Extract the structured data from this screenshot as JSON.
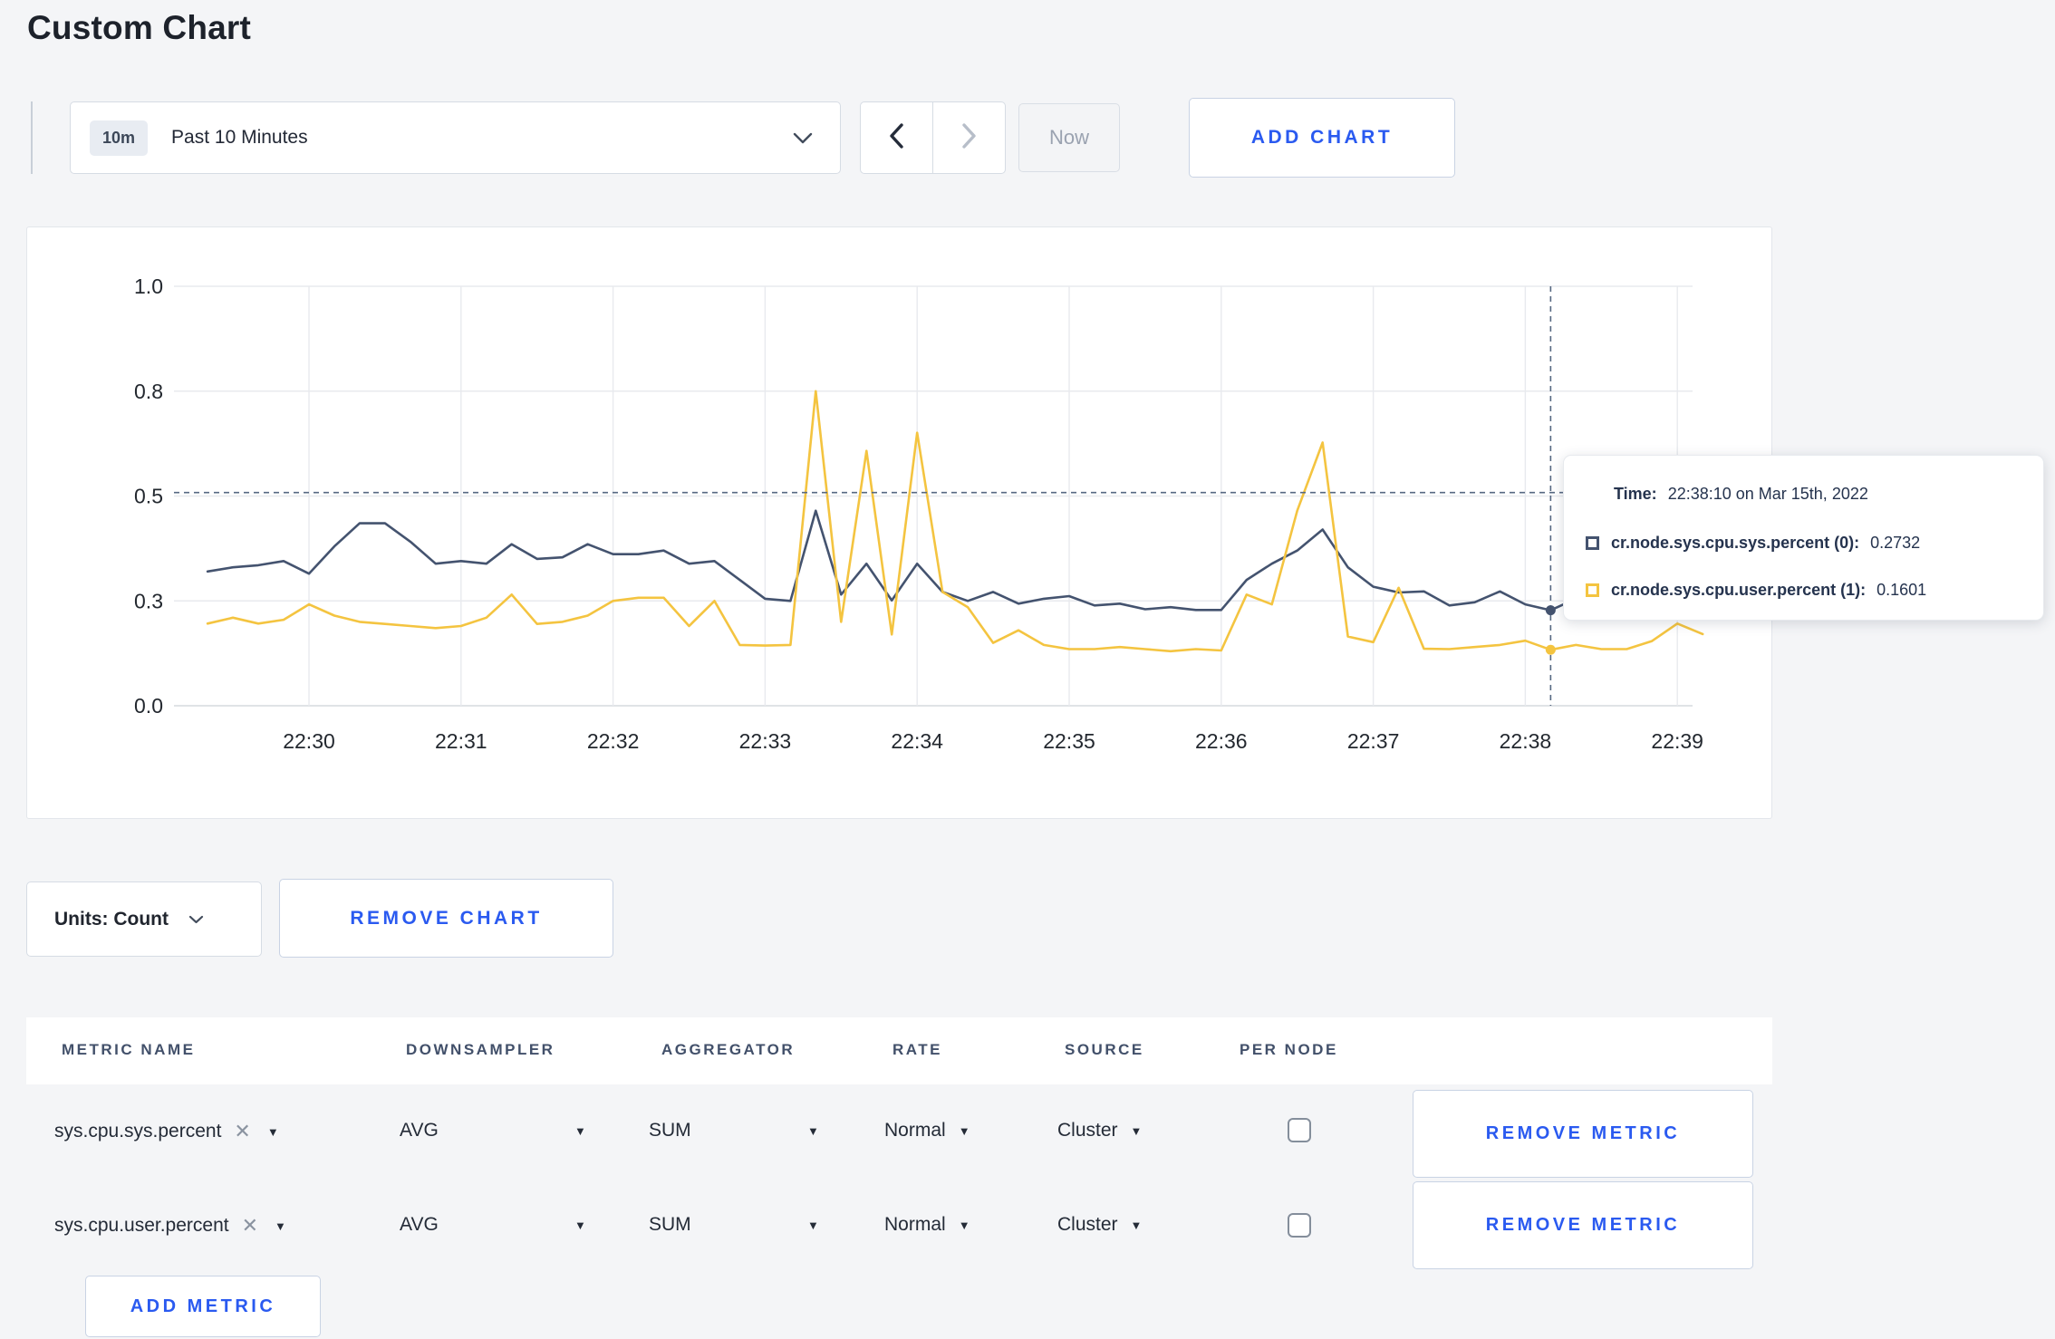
{
  "page": {
    "title": "Custom Chart"
  },
  "toolbar": {
    "time_window_badge": "10m",
    "time_window_label": "Past 10 Minutes",
    "now_label": "Now",
    "add_chart_label": "ADD CHART"
  },
  "chart_data": {
    "type": "line",
    "title": "",
    "xlabel": "",
    "ylabel": "",
    "grid": true,
    "legend_position": "tooltip",
    "x_start": "22:29:20",
    "x_interval_seconds": 10,
    "x_ticks": [
      "22:30",
      "22:31",
      "22:32",
      "22:33",
      "22:34",
      "22:35",
      "22:36",
      "22:37",
      "22:38",
      "22:39"
    ],
    "y_tick_labels": [
      "0.0",
      "0.3",
      "0.5",
      "0.8",
      "1.0"
    ],
    "y_tick_values": [
      0,
      0.3,
      0.5,
      0.8,
      1.0
    ],
    "series": [
      {
        "name": "cr.node.sys.cpu.sys.percent",
        "color": "#44536f",
        "values": [
          0.356,
          0.364,
          0.368,
          0.376,
          0.352,
          0.404,
          0.448,
          0.448,
          0.413,
          0.371,
          0.376,
          0.371,
          0.408,
          0.38,
          0.383,
          0.408,
          0.389,
          0.389,
          0.396,
          0.371,
          0.376,
          0.34,
          0.304,
          0.3,
          0.472,
          0.312,
          0.371,
          0.301,
          0.371,
          0.317,
          0.3,
          0.317,
          0.292,
          0.304,
          0.309,
          0.287,
          0.292,
          0.276,
          0.282,
          0.274,
          0.274,
          0.34,
          0.371,
          0.396,
          0.436,
          0.364,
          0.327,
          0.316,
          0.318,
          0.287,
          0.296,
          0.318,
          0.29,
          0.2732,
          0.304,
          0.31,
          0.306,
          0.312,
          0.316,
          0.31
        ]
      },
      {
        "name": "cr.node.sys.cpu.user.percent",
        "color": "#f4c440",
        "values": [
          0.235,
          0.252,
          0.235,
          0.246,
          0.29,
          0.258,
          0.24,
          0.234,
          0.228,
          0.222,
          0.228,
          0.252,
          0.312,
          0.234,
          0.24,
          0.258,
          0.3,
          0.306,
          0.306,
          0.228,
          0.3,
          0.174,
          0.172,
          0.174,
          0.8,
          0.24,
          0.629,
          0.204,
          0.681,
          0.317,
          0.282,
          0.18,
          0.216,
          0.174,
          0.162,
          0.162,
          0.168,
          0.162,
          0.156,
          0.162,
          0.158,
          0.312,
          0.29,
          0.472,
          0.653,
          0.198,
          0.182,
          0.325,
          0.163,
          0.162,
          0.168,
          0.174,
          0.186,
          0.1601,
          0.174,
          0.162,
          0.162,
          0.185,
          0.235,
          0.205
        ]
      }
    ],
    "crosshair": {
      "time": "22:38:10",
      "point_index": 53,
      "guide_value": 0.51
    }
  },
  "tooltip": {
    "time_label": "Time:",
    "time_value": "22:38:10 on Mar 15th, 2022",
    "series": [
      {
        "name": "cr.node.sys.cpu.sys.percent (0):",
        "value": "0.2732",
        "color": "#44536f"
      },
      {
        "name": "cr.node.sys.cpu.user.percent (1):",
        "value": "0.1601",
        "color": "#f4c440"
      }
    ]
  },
  "chart_footer": {
    "units_label": "Units: Count",
    "remove_chart_label": "REMOVE CHART"
  },
  "metrics_table": {
    "headers": [
      "METRIC NAME",
      "DOWNSAMPLER",
      "AGGREGATOR",
      "RATE",
      "SOURCE",
      "PER NODE"
    ],
    "remove_metric_label": "REMOVE METRIC",
    "add_metric_label": "ADD METRIC",
    "rows": [
      {
        "metric": "sys.cpu.sys.percent",
        "downsampler": "AVG",
        "aggregator": "SUM",
        "rate": "Normal",
        "source": "Cluster",
        "per_node_checked": false
      },
      {
        "metric": "sys.cpu.user.percent",
        "downsampler": "AVG",
        "aggregator": "SUM",
        "rate": "Normal",
        "source": "Cluster",
        "per_node_checked": false
      }
    ]
  },
  "colors": {
    "accent_blue": "#2a5af0",
    "page_background": "#f4f5f7",
    "crosshair": "#566882"
  }
}
